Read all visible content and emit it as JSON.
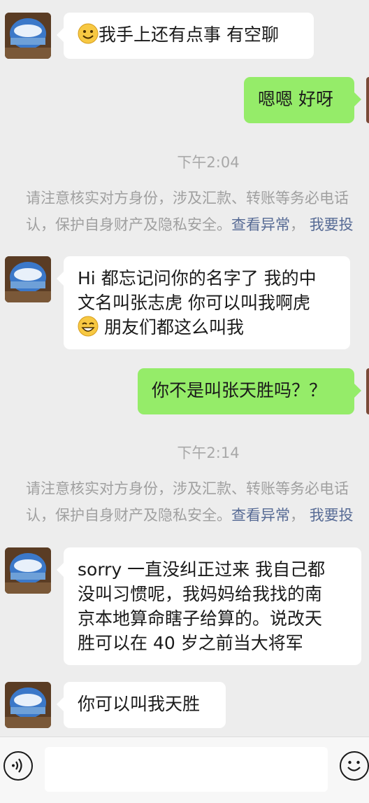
{
  "messages": [
    {
      "side": "left",
      "text": "我手上还有点事 有空聊"
    },
    {
      "side": "right",
      "text": "嗯嗯 好呀"
    },
    {
      "type": "time",
      "text": "下午2:04"
    },
    {
      "type": "notice",
      "text": "请注意核实对方身份，涉及汇款、转账等务必电话",
      "text2": "认，保护自身财产及隐私安全。",
      "link1": "查看异常",
      "sep": "，",
      "link2": "我要投"
    },
    {
      "side": "left",
      "lines": [
        "Hi 都忘记问你的名字了 我的中",
        "文名叫张志虎 你可以叫我啊虎",
        "朋友们都这么叫我"
      ]
    },
    {
      "side": "right",
      "text": "你不是叫张天胜吗？？"
    },
    {
      "type": "time",
      "text": "下午2:14"
    },
    {
      "type": "notice",
      "text": "请注意核实对方身份，涉及汇款、转账等务必电话",
      "text2": "认，保护自身财产及隐私安全。",
      "link1": "查看异常",
      "sep": "，",
      "link2": "我要投"
    },
    {
      "side": "left",
      "lines": [
        "sorry 一直没纠正过来 我自己都",
        "没叫习惯呢，我妈妈给我找的南",
        "京本地算命瞎子给算的。说改天",
        "胜可以在 40 岁之前当大将军"
      ]
    },
    {
      "side": "left",
      "text": "你可以叫我天胜"
    }
  ],
  "icons": {
    "voice": "voice-icon",
    "emoji": "emoji-icon",
    "smile": "smiley-emoji",
    "grin": "grin-emoji"
  },
  "colors": {
    "self_bubble": "#95ec69",
    "other_bubble": "#ffffff",
    "background": "#ededed",
    "link": "#576b95"
  }
}
